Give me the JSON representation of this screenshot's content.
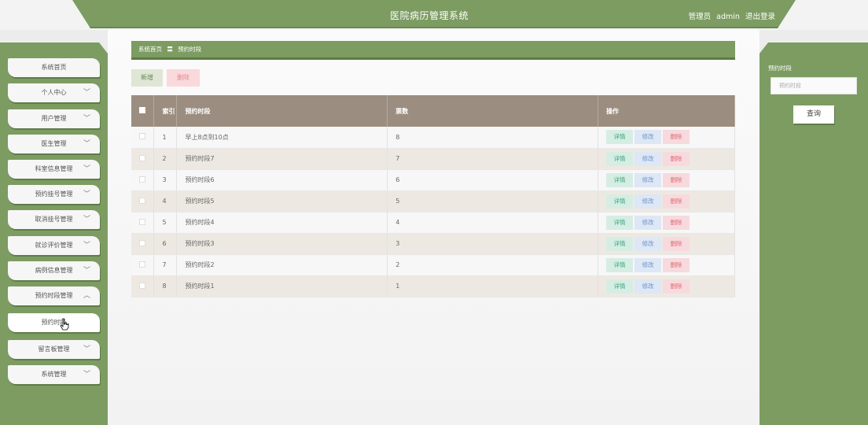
{
  "header": {
    "title": "医院病历管理系统",
    "user_role": "管理员",
    "user_name": "admin",
    "logout": "退出登录"
  },
  "sidebar": {
    "items": [
      {
        "label": "系统首页",
        "chevron": ""
      },
      {
        "label": "个人中心",
        "chevron": "down"
      },
      {
        "label": "用户管理",
        "chevron": "down"
      },
      {
        "label": "医生管理",
        "chevron": "down"
      },
      {
        "label": "科室信息管理",
        "chevron": "down"
      },
      {
        "label": "预约挂号管理",
        "chevron": "down"
      },
      {
        "label": "取消挂号管理",
        "chevron": "down"
      },
      {
        "label": "就诊评价管理",
        "chevron": "down"
      },
      {
        "label": "病例信息管理",
        "chevron": "down"
      },
      {
        "label": "预约时段管理",
        "chevron": "up"
      },
      {
        "label": "预约时段",
        "chevron": ""
      },
      {
        "label": "留言板管理",
        "chevron": "down"
      },
      {
        "label": "系统管理",
        "chevron": "down"
      }
    ]
  },
  "breadcrumb": {
    "home": "系统首页",
    "separator": "〓",
    "current": "预约时段"
  },
  "toolbar": {
    "add": "新增",
    "delete": "删除"
  },
  "table": {
    "headers": [
      "索引",
      "预约时段",
      "票数",
      "操作"
    ],
    "actions": {
      "detail": "详情",
      "edit": "修改",
      "remove": "删除"
    },
    "rows": [
      {
        "index": "1",
        "name": "早上8点到10点",
        "count": "8"
      },
      {
        "index": "2",
        "name": "预约时段7",
        "count": "7"
      },
      {
        "index": "3",
        "name": "预约时段6",
        "count": "6"
      },
      {
        "index": "4",
        "name": "预约时段5",
        "count": "5"
      },
      {
        "index": "5",
        "name": "预约时段4",
        "count": "4"
      },
      {
        "index": "6",
        "name": "预约时段3",
        "count": "3"
      },
      {
        "index": "7",
        "name": "预约时段2",
        "count": "2"
      },
      {
        "index": "8",
        "name": "预约时段1",
        "count": "1"
      }
    ]
  },
  "search": {
    "label": "预约时段",
    "placeholder": "预约时段",
    "button": "查询"
  },
  "colors": {
    "accent_green": "#7c9c62",
    "header_brown": "#9b8d80",
    "detail": "#3aa57d",
    "edit": "#6f94c9",
    "remove": "#df6a76"
  }
}
